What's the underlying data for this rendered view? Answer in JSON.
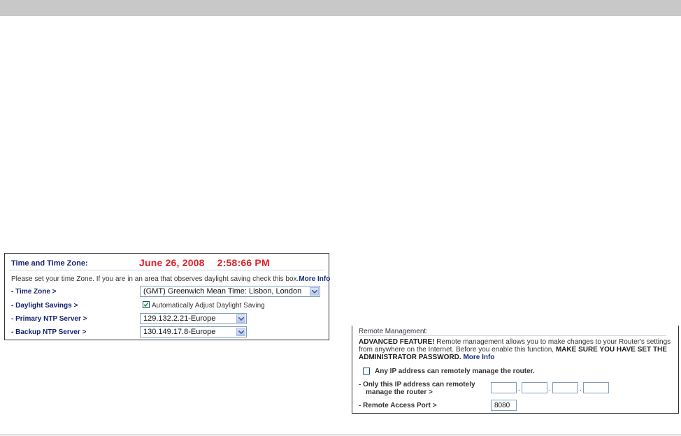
{
  "time_zone_panel": {
    "title": "Time and Time Zone:",
    "date": "June 26, 2008",
    "time": "2:58:66 PM",
    "intro": "Please set your time Zone. If you are in an area that observes daylight saving check this box.",
    "more_info": "More Info",
    "time_zone_label": "- Time Zone >",
    "time_zone_value": "(GMT) Greenwich Mean Time: Lisbon, London",
    "daylight_label": "- Daylight Savings >",
    "daylight_checked": true,
    "daylight_checkbox_label": "Automatically Adjust Daylight Saving",
    "primary_ntp_label": "- Primary NTP Server >",
    "primary_ntp_value": "129.132.2.21-Europe",
    "backup_ntp_label": "- Backup NTP Server >",
    "backup_ntp_value": "130.149.17.8-Europe",
    "date_color": "#e0202a",
    "label_color": "#12236e"
  },
  "remote_panel": {
    "title": "Remote Management:",
    "advanced_label": "ADVANCED FEATURE!",
    "desc_text": " Remote management allows you to make changes to your Router's settings from anywhere on the Internet. Before you enable this function, ",
    "warning": "MAKE SURE YOU HAVE SET THE ADMINISTRATOR PASSWORD.",
    "more_info": "More Info",
    "any_ip_checked": false,
    "any_ip_label": "Any IP address can remotely manage the router.",
    "only_ip_label_1": "- Only this IP address can remotely",
    "only_ip_label_2": "manage the router >",
    "ip_octets": [
      "",
      "",
      "",
      ""
    ],
    "port_label": "- Remote Access Port >",
    "port_value": "8080"
  }
}
